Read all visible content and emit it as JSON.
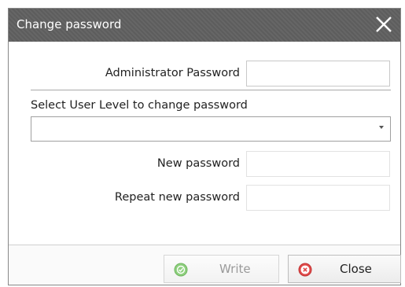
{
  "dialog": {
    "title": "Change password",
    "close_icon": "close-x-icon"
  },
  "form": {
    "admin_password_label": "Administrator Password",
    "admin_password_value": "",
    "select_label": "Select User Level to change password",
    "select_value": "",
    "new_password_label": "New password",
    "new_password_value": "",
    "repeat_password_label": "Repeat new password",
    "repeat_password_value": ""
  },
  "buttons": {
    "write_label": "Write",
    "write_icon": "check-circle-icon",
    "close_label": "Close",
    "close_icon": "close-circle-icon"
  },
  "colors": {
    "titlebar": "#5d5d5d",
    "write_icon": "#7ac36a",
    "close_icon": "#e04b4b"
  }
}
